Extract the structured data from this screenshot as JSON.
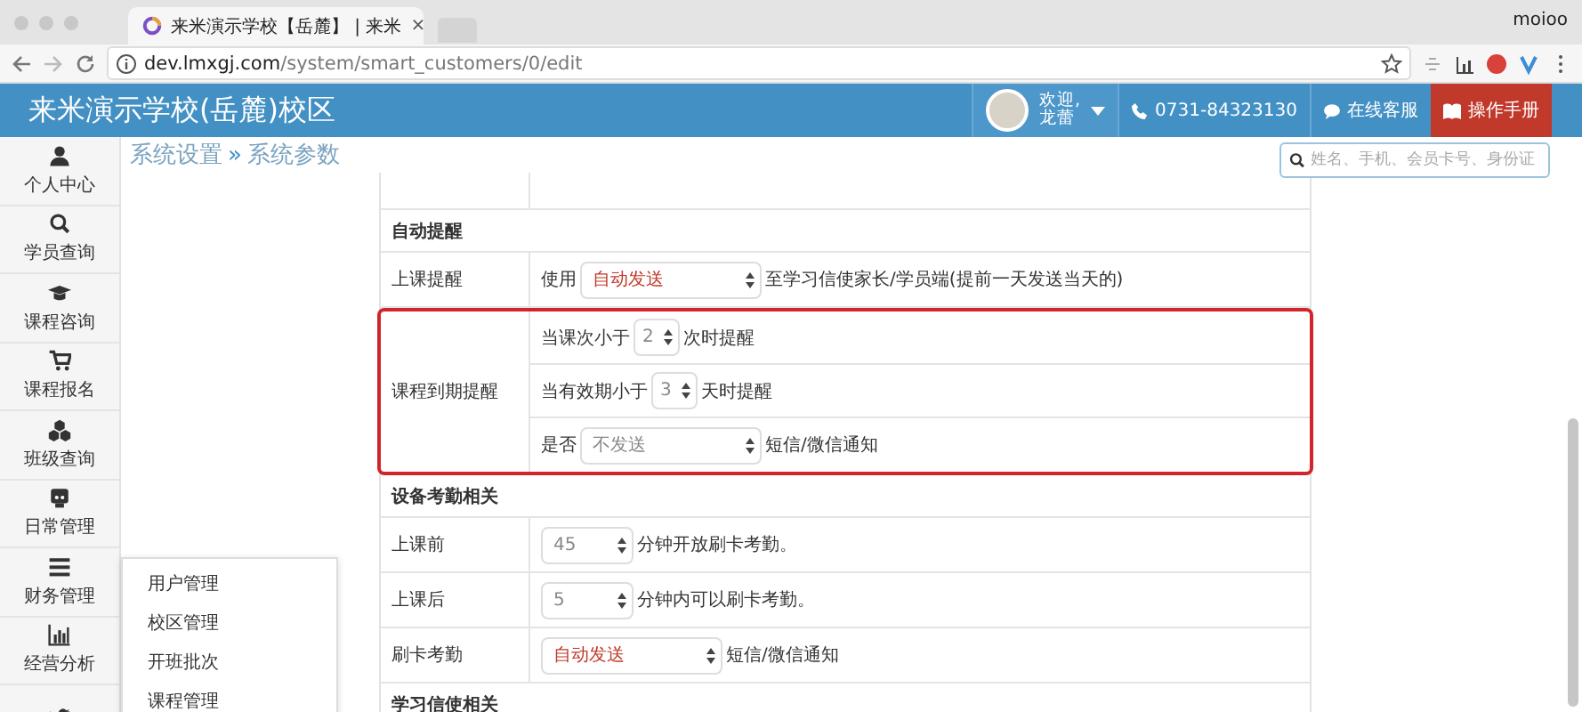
{
  "browser": {
    "tab": {
      "title": "来米演示学校【岳麓】 | 来米",
      "close": "×"
    },
    "profile": "moioo",
    "address": {
      "domain": "dev.lmxgj.com",
      "path": "/system/smart_customers/0/edit"
    }
  },
  "header": {
    "title": "来米演示学校(岳麓)校区",
    "user": {
      "greeting": "欢迎,",
      "name": "龙蕾"
    },
    "phone": "0731-84323130",
    "support": "在线客服",
    "manual": "操作手册"
  },
  "sidebar": {
    "items": [
      {
        "kind": "person",
        "label": "个人中心"
      },
      {
        "kind": "search",
        "label": "学员查询"
      },
      {
        "kind": "cap",
        "label": "课程咨询"
      },
      {
        "kind": "cart",
        "label": "课程报名"
      },
      {
        "kind": "cubes",
        "label": "班级查询"
      },
      {
        "kind": "robot",
        "label": "日常管理"
      },
      {
        "kind": "bars",
        "label": "财务管理"
      },
      {
        "kind": "chart",
        "label": "经营分析"
      },
      {
        "kind": "bird"
      }
    ]
  },
  "breadcrumb": {
    "parent": "系统设置",
    "separator": "»",
    "current": "系统参数"
  },
  "search": {
    "placeholder": "姓名、手机、会员卡号、身份证"
  },
  "settings": {
    "rows": [
      {
        "kind": "cut"
      },
      {
        "kind": "section",
        "label": "自动提醒"
      },
      {
        "kind": "row",
        "label": "上课提醒",
        "parts": [
          {
            "kind": "text",
            "text": "使用"
          },
          {
            "kind": "select",
            "value": "自动发送",
            "emphasis": true
          },
          {
            "kind": "text",
            "text": "至学习信使家长/学员端(提前一天发送当天的)"
          }
        ]
      },
      {
        "kind": "group",
        "label": "课程到期提醒",
        "highlighted": true,
        "lines": [
          [
            {
              "kind": "text",
              "text": "当课次小于"
            },
            {
              "kind": "spinner",
              "value": "2",
              "emphasis": false
            },
            {
              "kind": "text",
              "text": "次时提醒"
            }
          ],
          [
            {
              "kind": "text",
              "text": "当有效期小于"
            },
            {
              "kind": "spinner",
              "value": "3",
              "emphasis": false
            },
            {
              "kind": "text",
              "text": "天时提醒"
            }
          ],
          [
            {
              "kind": "text",
              "text": "是否"
            },
            {
              "kind": "select",
              "value": "不发送",
              "emphasis": false
            },
            {
              "kind": "text",
              "text": "短信/微信通知"
            }
          ]
        ]
      },
      {
        "kind": "section",
        "label": "设备考勤相关"
      },
      {
        "kind": "row",
        "label": "上课前",
        "parts": [
          {
            "kind": "number",
            "value": "45",
            "emphasis": false
          },
          {
            "kind": "text",
            "text": "分钟开放刷卡考勤。"
          }
        ]
      },
      {
        "kind": "row",
        "label": "上课后",
        "parts": [
          {
            "kind": "number",
            "value": "5",
            "emphasis": false
          },
          {
            "kind": "text",
            "text": "分钟内可以刷卡考勤。"
          }
        ]
      },
      {
        "kind": "row",
        "label": "刷卡考勤",
        "parts": [
          {
            "kind": "select",
            "value": "自动发送",
            "emphasis": true
          },
          {
            "kind": "text",
            "text": "短信/微信通知"
          }
        ]
      },
      {
        "kind": "section",
        "label": "学习信使相关"
      }
    ]
  },
  "submenu": {
    "items": [
      "用户管理",
      "校区管理",
      "开班批次",
      "课程管理"
    ]
  }
}
